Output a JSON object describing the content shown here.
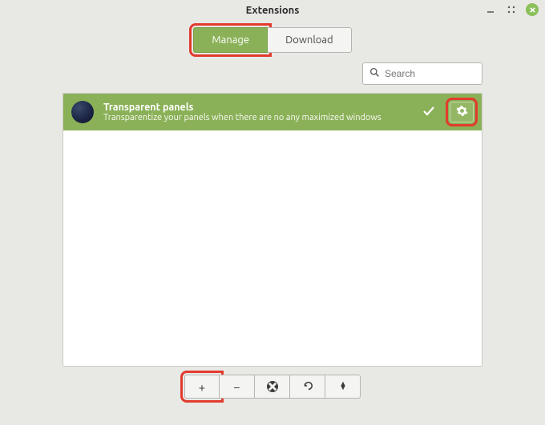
{
  "window": {
    "title": "Extensions"
  },
  "tabs": {
    "manage": "Manage",
    "download": "Download",
    "active": "manage"
  },
  "search": {
    "placeholder": "Search",
    "value": ""
  },
  "extensions": [
    {
      "title": "Transparent panels",
      "description": "Transparentize your panels when there are no any maximized windows",
      "enabled": true
    }
  ],
  "toolbar": {
    "add": "+",
    "remove": "−"
  },
  "colors": {
    "accent": "#8bb158",
    "highlight": "#e23b2e"
  }
}
